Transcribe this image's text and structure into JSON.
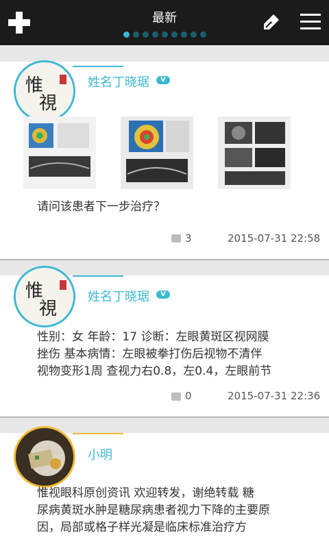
{
  "header": {
    "title": "最新",
    "page_dots": 9,
    "active_dot": 0,
    "add_icon": "plus-icon",
    "compose_icon": "pen-icon",
    "menu_icon": "hamburger-menu-icon"
  },
  "colors": {
    "accent": "#3db8d3",
    "header_bg": "#1b1b1b",
    "highlight_ring": "#f0bc37"
  },
  "posts": [
    {
      "author": "姓名丁晓琚",
      "verified_badge": "V",
      "text": "请问该患者下一步治疗？",
      "comments": "3",
      "time": "2015-07-31 22:58"
    },
    {
      "author": "姓名丁晓琚",
      "verified_badge": "V",
      "text_lines": [
        "性别：女 年龄：17 诊断：左眼黄斑区视网膜",
        "挫伤 基本病情：左眼被拳打伤后视物不清伴",
        "视物变形1周 查视力右0.8，左0.4，左眼前节"
      ],
      "comments": "0",
      "time": "2015-07-31 22:36"
    },
    {
      "author": "小明",
      "text_lines": [
        " 惟视眼科原创资讯 欢迎转发，谢绝转载  糖",
        "尿病黄斑水肿是糖尿病患者视力下降的主要原",
        "因，局部或格子样光凝是临床标准治疗方"
      ]
    }
  ]
}
